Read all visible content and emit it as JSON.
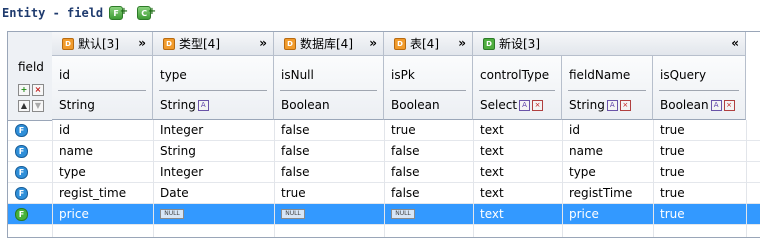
{
  "title": {
    "entity_label": "Entity - field",
    "icons": [
      "add-field-icon",
      "add-column-icon"
    ]
  },
  "corner": {
    "label": "field",
    "icons": [
      "add-row-icon",
      "delete-row-icon",
      "move-up-icon",
      "move-down-icon"
    ]
  },
  "groups": [
    {
      "label": "默认[3]",
      "icon": "orange-group-icon",
      "toggle": "»"
    },
    {
      "label": "类型[4]",
      "icon": "orange-group-icon",
      "toggle": "»"
    },
    {
      "label": "数据库[4]",
      "icon": "orange-group-icon",
      "toggle": "»"
    },
    {
      "label": "表[4]",
      "icon": "orange-group-icon",
      "toggle": "»"
    },
    {
      "label": "新设[3]",
      "icon": "green-group-icon",
      "toggle": "«"
    }
  ],
  "columns": [
    {
      "name": "id",
      "type": "String"
    },
    {
      "name": "type",
      "type": "String"
    },
    {
      "name": "isNull",
      "type": "Boolean"
    },
    {
      "name": "isPk",
      "type": "Boolean"
    },
    {
      "name": "controlType",
      "type": "Select"
    },
    {
      "name": "fieldName",
      "type": "String"
    },
    {
      "name": "isQuery",
      "type": "Boolean"
    }
  ],
  "rows": [
    {
      "id": "id",
      "type": "Integer",
      "isNull": "false",
      "isPk": "true",
      "controlType": "text",
      "fieldName": "id",
      "isQuery": "true",
      "selected": false
    },
    {
      "id": "name",
      "type": "String",
      "isNull": "false",
      "isPk": "false",
      "controlType": "text",
      "fieldName": "name",
      "isQuery": "true",
      "selected": false
    },
    {
      "id": "type",
      "type": "Integer",
      "isNull": "false",
      "isPk": "false",
      "controlType": "text",
      "fieldName": "type",
      "isQuery": "true",
      "selected": false
    },
    {
      "id": "regist_time",
      "type": "Date",
      "isNull": "true",
      "isPk": "false",
      "controlType": "text",
      "fieldName": "registTime",
      "isQuery": "true",
      "selected": false
    },
    {
      "id": "price",
      "type": "NULL",
      "isNull": "NULL",
      "isPk": "NULL",
      "controlType": "text",
      "fieldName": "price",
      "isQuery": "true",
      "selected": true
    }
  ],
  "null_label": "NULL",
  "row_icon_letter": "F",
  "colors": {
    "selection": "#3399ff",
    "title_text": "#1f3b6e",
    "orange_icon": "#f19b2c",
    "green_icon": "#4fae3f",
    "blue_icon": "#2f8fd9"
  }
}
